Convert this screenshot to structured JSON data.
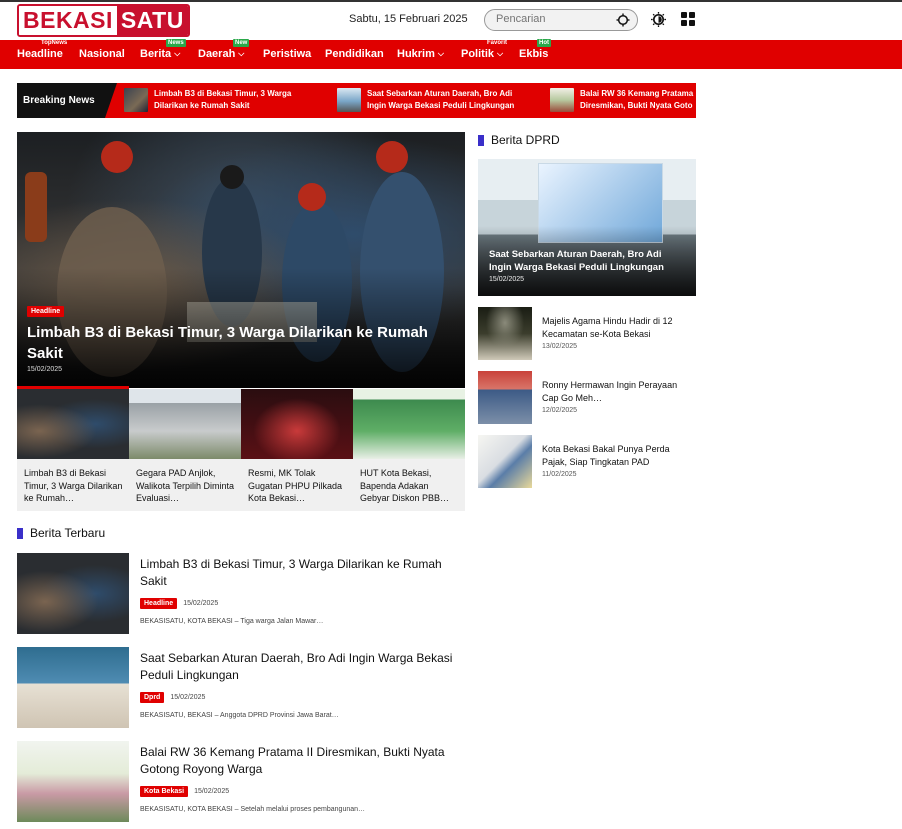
{
  "header": {
    "logo_left": "BEKASI",
    "logo_right": "SATU",
    "date": "Sabtu, 15 Februari 2025",
    "search_placeholder": "Pencarian"
  },
  "nav": [
    {
      "label": "Headline",
      "badge": "TopNews",
      "badge_style": "plain",
      "chevron": false
    },
    {
      "label": "Nasional",
      "badge": "",
      "chevron": false
    },
    {
      "label": "Berita",
      "badge": "News",
      "badge_style": "green",
      "chevron": true
    },
    {
      "label": "Daerah",
      "badge": "New",
      "badge_style": "green",
      "chevron": true
    },
    {
      "label": "Peristiwa",
      "badge": "",
      "chevron": false
    },
    {
      "label": "Pendidikan",
      "badge": "",
      "chevron": false
    },
    {
      "label": "Hukrim",
      "badge": "",
      "chevron": true
    },
    {
      "label": "Politik",
      "badge": "Favorit",
      "badge_style": "plain",
      "chevron": true
    },
    {
      "label": "Ekbis",
      "badge": "Hot",
      "badge_style": "green",
      "chevron": false
    }
  ],
  "breaking": {
    "label": "Breaking News",
    "items": [
      {
        "line1": "Limbah B3 di Bekasi Timur, 3 Warga",
        "line2": "Dilarikan ke Rumah Sakit"
      },
      {
        "line1": "Saat Sebarkan Aturan Daerah, Bro Adi",
        "line2": "Ingin Warga Bekasi Peduli Lingkungan"
      },
      {
        "line1": "Balai RW 36 Kemang Pratama",
        "line2": "Diresmikan, Bukti Nyata Goto"
      }
    ]
  },
  "hero": {
    "tag": "Headline",
    "title": "Limbah B3 di Bekasi Timur, 3 Warga Dilarikan ke Rumah Sakit",
    "date": "15/02/2025"
  },
  "thumbs": [
    {
      "title": "Limbah B3 di Bekasi Timur, 3 Warga Dilarikan ke Rumah…"
    },
    {
      "title": "Gegara PAD Anjlok, Walikota Terpilih Diminta Evaluasi…"
    },
    {
      "title": "Resmi, MK Tolak Gugatan PHPU Pilkada Kota Bekasi…"
    },
    {
      "title": "HUT Kota Bekasi, Bapenda Adakan Gebyar Diskon PBB…"
    }
  ],
  "terbaru": {
    "heading": "Berita Terbaru",
    "items": [
      {
        "title": "Limbah B3 di Bekasi Timur, 3 Warga Dilarikan ke Rumah Sakit",
        "tag": "Headline",
        "date": "15/02/2025",
        "excerpt": "BEKASISATU, KOTA BEKASI – Tiga warga Jalan Mawar…"
      },
      {
        "title": "Saat Sebarkan Aturan Daerah, Bro Adi Ingin Warga Bekasi Peduli Lingkungan",
        "tag": "Dprd",
        "date": "15/02/2025",
        "excerpt": "BEKASISATU, BEKASI – Anggota DPRD Provinsi Jawa Barat…"
      },
      {
        "title": "Balai RW 36 Kemang Pratama II Diresmikan, Bukti Nyata Gotong Royong Warga",
        "tag": "Kota Bekasi",
        "date": "15/02/2025",
        "excerpt": "BEKASISATU, KOTA BEKASI – Setelah melalui proses pembangunan…"
      }
    ]
  },
  "dprd": {
    "heading": "Berita DPRD",
    "main": {
      "title": "Saat Sebarkan Aturan Daerah, Bro Adi Ingin Warga Bekasi Peduli Lingkungan",
      "date": "15/02/2025"
    },
    "items": [
      {
        "title": "Majelis Agama Hindu Hadir di 12 Kecamatan se-Kota Bekasi",
        "date": "13/02/2025"
      },
      {
        "title": "Ronny Hermawan Ingin Perayaan Cap Go Meh…",
        "date": "12/02/2025"
      },
      {
        "title": "Kota Bekasi Bakal Punya Perda Pajak, Siap Tingkatan PAD",
        "date": "11/02/2025"
      }
    ]
  },
  "colors": {
    "brand_red": "#e00000",
    "logo_red": "#c8102e",
    "section_mark": "#3a2fc9",
    "badge_green": "#2aa84a"
  }
}
